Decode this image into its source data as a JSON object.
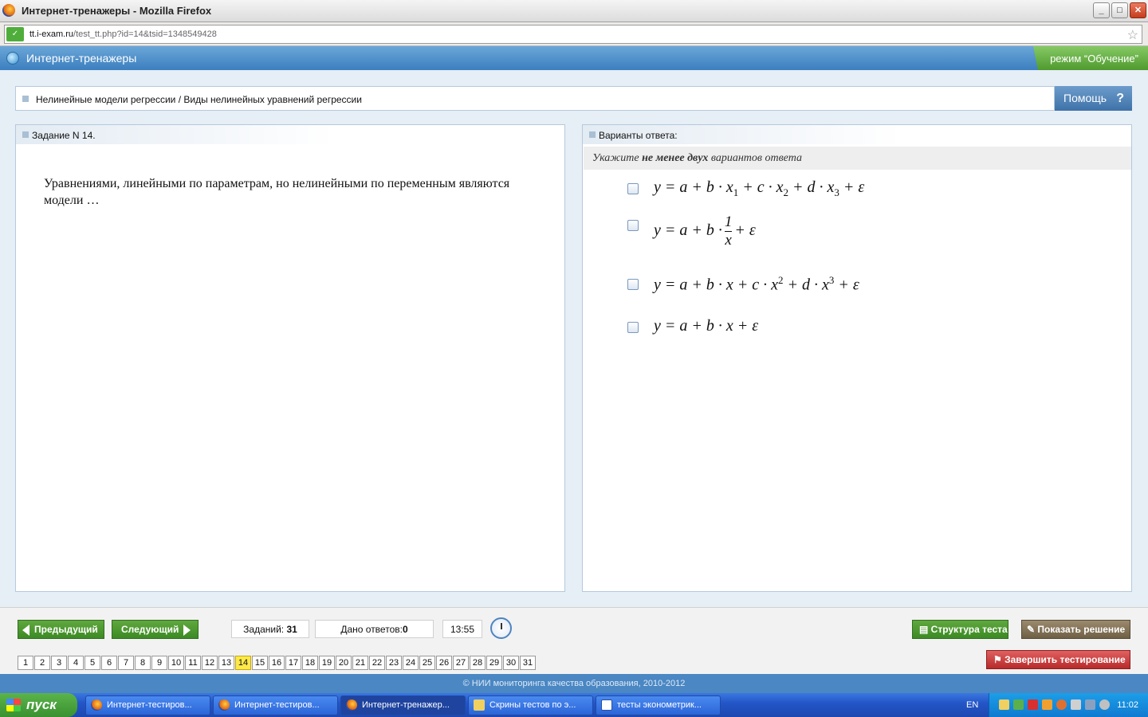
{
  "window": {
    "title": "Интернет-тренажеры - Mozilla Firefox"
  },
  "address": {
    "url_domain": "tt.i-exam.ru",
    "url_path": "/test_tt.php?id=14&tsid=1348549428"
  },
  "app": {
    "title": "Интернет-тренажеры",
    "mode": "режим “Обучение”"
  },
  "breadcrumb": "Нелинейные модели регрессии / Виды нелинейных уравнений регрессии",
  "help_label": "Помощь",
  "task": {
    "header": "Задание N 14.",
    "question": "Уравнениями, линейными по параметрам, но нелинейными по переменным являются модели …"
  },
  "answers": {
    "header": "Варианты ответа:",
    "instruction_pre": "Укажите ",
    "instruction_bold": "не менее двух",
    "instruction_post": " вариантов ответа"
  },
  "nav": {
    "prev_label": "Предыдущий",
    "next_label": "Следующий",
    "tasks_label": "Заданий:",
    "tasks_count": "31",
    "answers_label": "Дано ответов:",
    "answers_count": "0",
    "time": "13:55",
    "structure_label": "Структура теста",
    "solution_label": "Показать решение",
    "finish_label": "Завершить тестирование",
    "current": 14,
    "numbers": [
      "1",
      "2",
      "3",
      "4",
      "5",
      "6",
      "7",
      "8",
      "9",
      "10",
      "11",
      "12",
      "13",
      "14",
      "15",
      "16",
      "17",
      "18",
      "19",
      "20",
      "21",
      "22",
      "23",
      "24",
      "25",
      "26",
      "27",
      "28",
      "29",
      "30",
      "31"
    ]
  },
  "footer": "© НИИ мониторинга качества образования, 2010-2012",
  "taskbar": {
    "start_label": "пуск",
    "tasks": [
      "Интернет-тестиров...",
      "Интернет-тестиров...",
      "Интернет-тренажер...",
      "Скрины тестов по э...",
      "тесты эконометрик..."
    ],
    "lang": "EN",
    "clock": "11:02"
  },
  "colors": {
    "accent_blue": "#3c7fbf",
    "green_button": "#3c8a24",
    "mode_green": "#4f9a2e",
    "finish_red": "#c83a3a",
    "current_number": "#ffe94a"
  }
}
